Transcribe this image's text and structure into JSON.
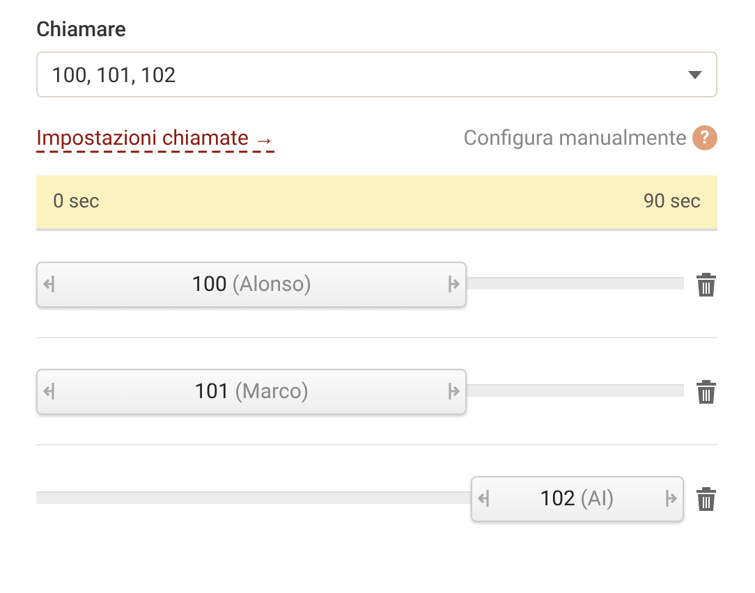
{
  "call_field": {
    "label": "Chiamare",
    "value": "100, 101, 102"
  },
  "settings_link": "Impostazioni chiamate →",
  "manual": {
    "label": "Configura manualmente",
    "help": "?"
  },
  "timeline": {
    "start": "0 sec",
    "end": "90 sec"
  },
  "ranges": [
    {
      "number": "100",
      "name": "(Alonso)",
      "kind": "leading",
      "level": 0.665
    },
    {
      "number": "101",
      "name": "(Marco)",
      "kind": "leading",
      "level": 0.665
    },
    {
      "number": "102",
      "name": "(AI)",
      "kind": "trailing",
      "level": 0.33
    }
  ]
}
